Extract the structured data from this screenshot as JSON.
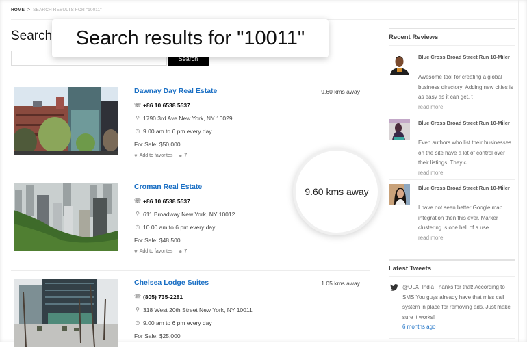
{
  "breadcrumb": {
    "home": "HOME",
    "separator": ">",
    "current": "SEARCH RESULTS FOR \"10011\""
  },
  "page_title": "Search results for \"10011\"",
  "callout_title": "Search results for \"10011\"",
  "search": {
    "value": "",
    "placeholder": "",
    "button_label": "Search"
  },
  "magnifier_text": "9.60 kms away",
  "listings": [
    {
      "name": "Dawnay Day Real Estate",
      "distance": "9.60 kms away",
      "phone": "+86 10 6538 5537",
      "address": "1790 3rd Ave New York, NY 10029",
      "hours": "9.00 am to 6 pm every day",
      "price": "For Sale: $50,000",
      "favorites_label": "Add to favorites",
      "comments": "7",
      "photo": "brick-and-glass-buildings-with-trees"
    },
    {
      "name": "Croman Real Estate",
      "distance": "9.60 kms away",
      "phone": "+86 10 6538 5537",
      "address": "611 Broadway New York, NY 10012",
      "hours": "10.00 am to 6 pm every day",
      "price": "For Sale: $48,500",
      "favorites_label": "Add to favorites",
      "comments": "7",
      "photo": "city-skyline-over-forest"
    },
    {
      "name": "Chelsea Lodge Suites",
      "distance": "1.05 kms away",
      "phone": "(805) 735-2281",
      "address": "318 West 20th Street New York, NY 10011",
      "hours": "9.00 am to 6 pm every day",
      "price": "For Sale: $25,000",
      "photo": "plaza-with-bare-trees"
    }
  ],
  "sidebar": {
    "recent_reviews": {
      "title": "Recent Reviews",
      "items": [
        {
          "title": "Blue Cross Broad Street Run 10-Miler",
          "body": "Awesome tool for creating a global business directory! Adding new cities is as easy as it can get, t",
          "more": "read more"
        },
        {
          "title": "Blue Cross Broad Street Run 10-Miler",
          "body": "Even authors who list their businesses on the site have a lot of control over their listings. They c",
          "more": "read more"
        },
        {
          "title": "Blue Cross Broad Street Run 10-Miler",
          "body": "I have not seen better Google map integration then this ever. Marker clustering is one hell of a use",
          "more": "read more"
        }
      ]
    },
    "latest_tweets": {
      "title": "Latest Tweets",
      "items": [
        {
          "body": "@OLX_India Thanks for that! According to SMS You guys already have that miss call system in place for removing ads. Just make sure it works!",
          "time": "6 months ago"
        }
      ]
    }
  },
  "colors": {
    "link_blue": "#1a6fc4",
    "button_black": "#000000",
    "divider": "#ececec"
  },
  "icons": {
    "phone": "☏",
    "map_pin": "⚲",
    "clock": "◷",
    "heart": "♥",
    "comment": "●",
    "twitter": "🐦"
  }
}
